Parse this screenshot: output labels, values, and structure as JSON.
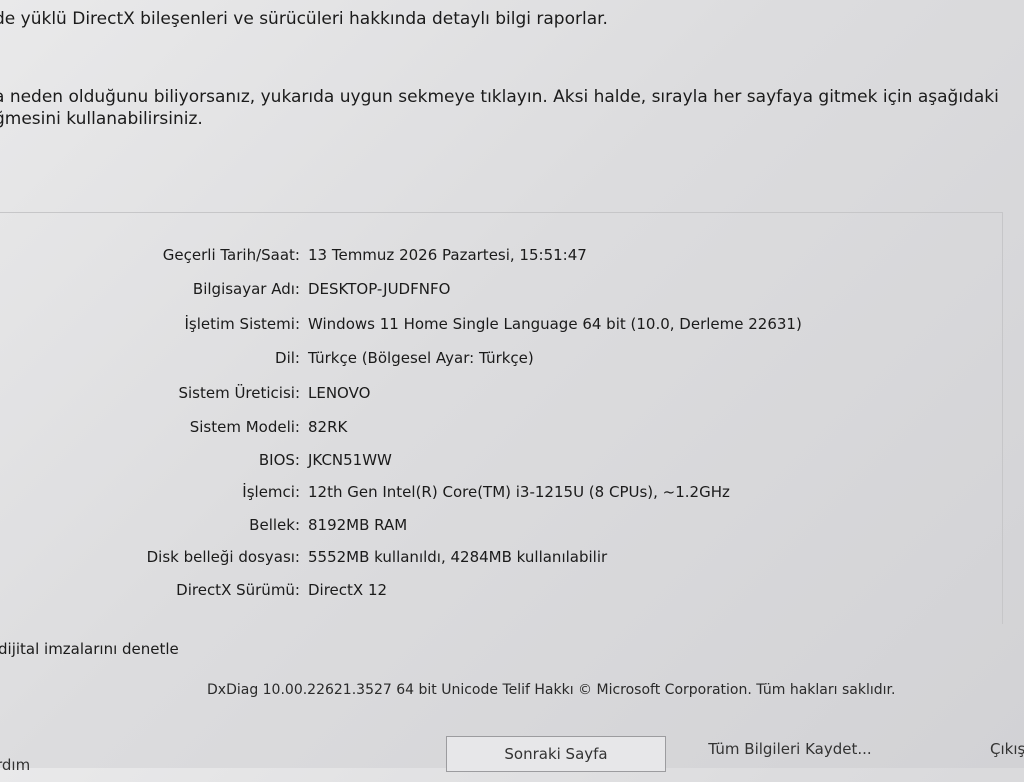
{
  "intro": {
    "line1": "de yüklü DirectX bileşenleri ve sürücüleri hakkında detaylı bilgi raporlar.",
    "line2": "a neden olduğunu biliyorsanız, yukarıda uygun sekmeye tıklayın. Aksi halde, sırayla her sayfaya gitmek için aşağıdaki",
    "line3": "ğmesini kullanabilirsiniz."
  },
  "system_info": [
    {
      "label": "Geçerli Tarih/Saat:",
      "value": "13 Temmuz 2026 Pazartesi, 15:51:47"
    },
    {
      "label": "Bilgisayar Adı:",
      "value": "DESKTOP-JUDFNFO"
    },
    {
      "label": "İşletim Sistemi:",
      "value": "Windows 11 Home Single Language 64 bit (10.0, Derleme 22631)"
    },
    {
      "label": "Dil:",
      "value": "Türkçe (Bölgesel Ayar: Türkçe)"
    },
    {
      "label": "Sistem Üreticisi:",
      "value": "LENOVO"
    },
    {
      "label": "Sistem Modeli:",
      "value": "82RK"
    },
    {
      "label": "BIOS:",
      "value": "JKCN51WW"
    },
    {
      "label": "İşlemci:",
      "value": "12th Gen Intel(R) Core(TM) i3-1215U (8 CPUs), ~1.2GHz"
    },
    {
      "label": "Bellek:",
      "value": "8192MB RAM"
    },
    {
      "label": "Disk belleği dosyası:",
      "value": "5552MB kullanıldı, 4284MB kullanılabilir"
    },
    {
      "label": "DirectX Sürümü:",
      "value": "DirectX 12"
    }
  ],
  "check_signatures_label": "dijital imzalarını denetle",
  "copyright": "DxDiag 10.00.22621.3527 64 bit Unicode  Telif Hakkı © Microsoft Corporation. Tüm hakları saklıdır.",
  "buttons": {
    "help": "rdım",
    "next_page": "Sonraki Sayfa",
    "save_all": "Tüm Bilgileri Kaydet...",
    "exit": "Çıkış"
  }
}
